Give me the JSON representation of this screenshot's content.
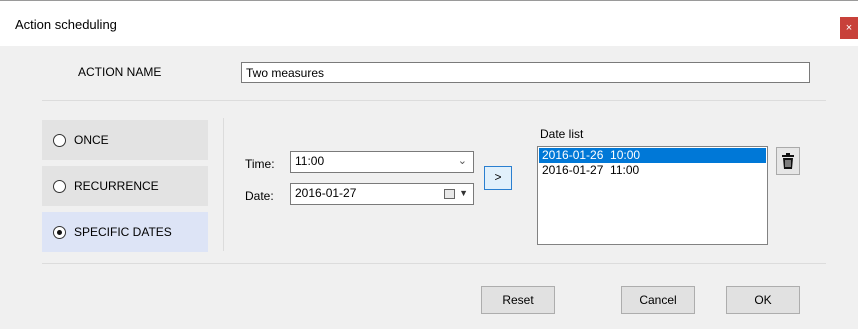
{
  "window": {
    "title": "Action scheduling",
    "close_glyph": "×"
  },
  "action": {
    "label": "ACTION NAME",
    "value": "Two measures"
  },
  "modes": [
    {
      "label": "ONCE",
      "selected": false
    },
    {
      "label": "RECURRENCE",
      "selected": false
    },
    {
      "label": "SPECIFIC DATES",
      "selected": true
    }
  ],
  "time": {
    "label": "Time:",
    "value": "11:00"
  },
  "date": {
    "label": "Date:",
    "value": "2016-01-27"
  },
  "add_button": {
    "label": ">"
  },
  "date_list": {
    "label": "Date list",
    "items": [
      {
        "text": "2016-01-26  10:00",
        "selected": true
      },
      {
        "text": "2016-01-27  11:00",
        "selected": false
      }
    ]
  },
  "buttons": {
    "reset": "Reset",
    "cancel": "Cancel",
    "ok": "OK"
  },
  "icons": {
    "delete": "trash-icon",
    "calendar": "calendar-icon",
    "dropdown": "chevron-down-icon"
  },
  "colors": {
    "selection": "#0078d7",
    "close": "#c8413a",
    "selected_mode_bg": "#dde4f6"
  }
}
